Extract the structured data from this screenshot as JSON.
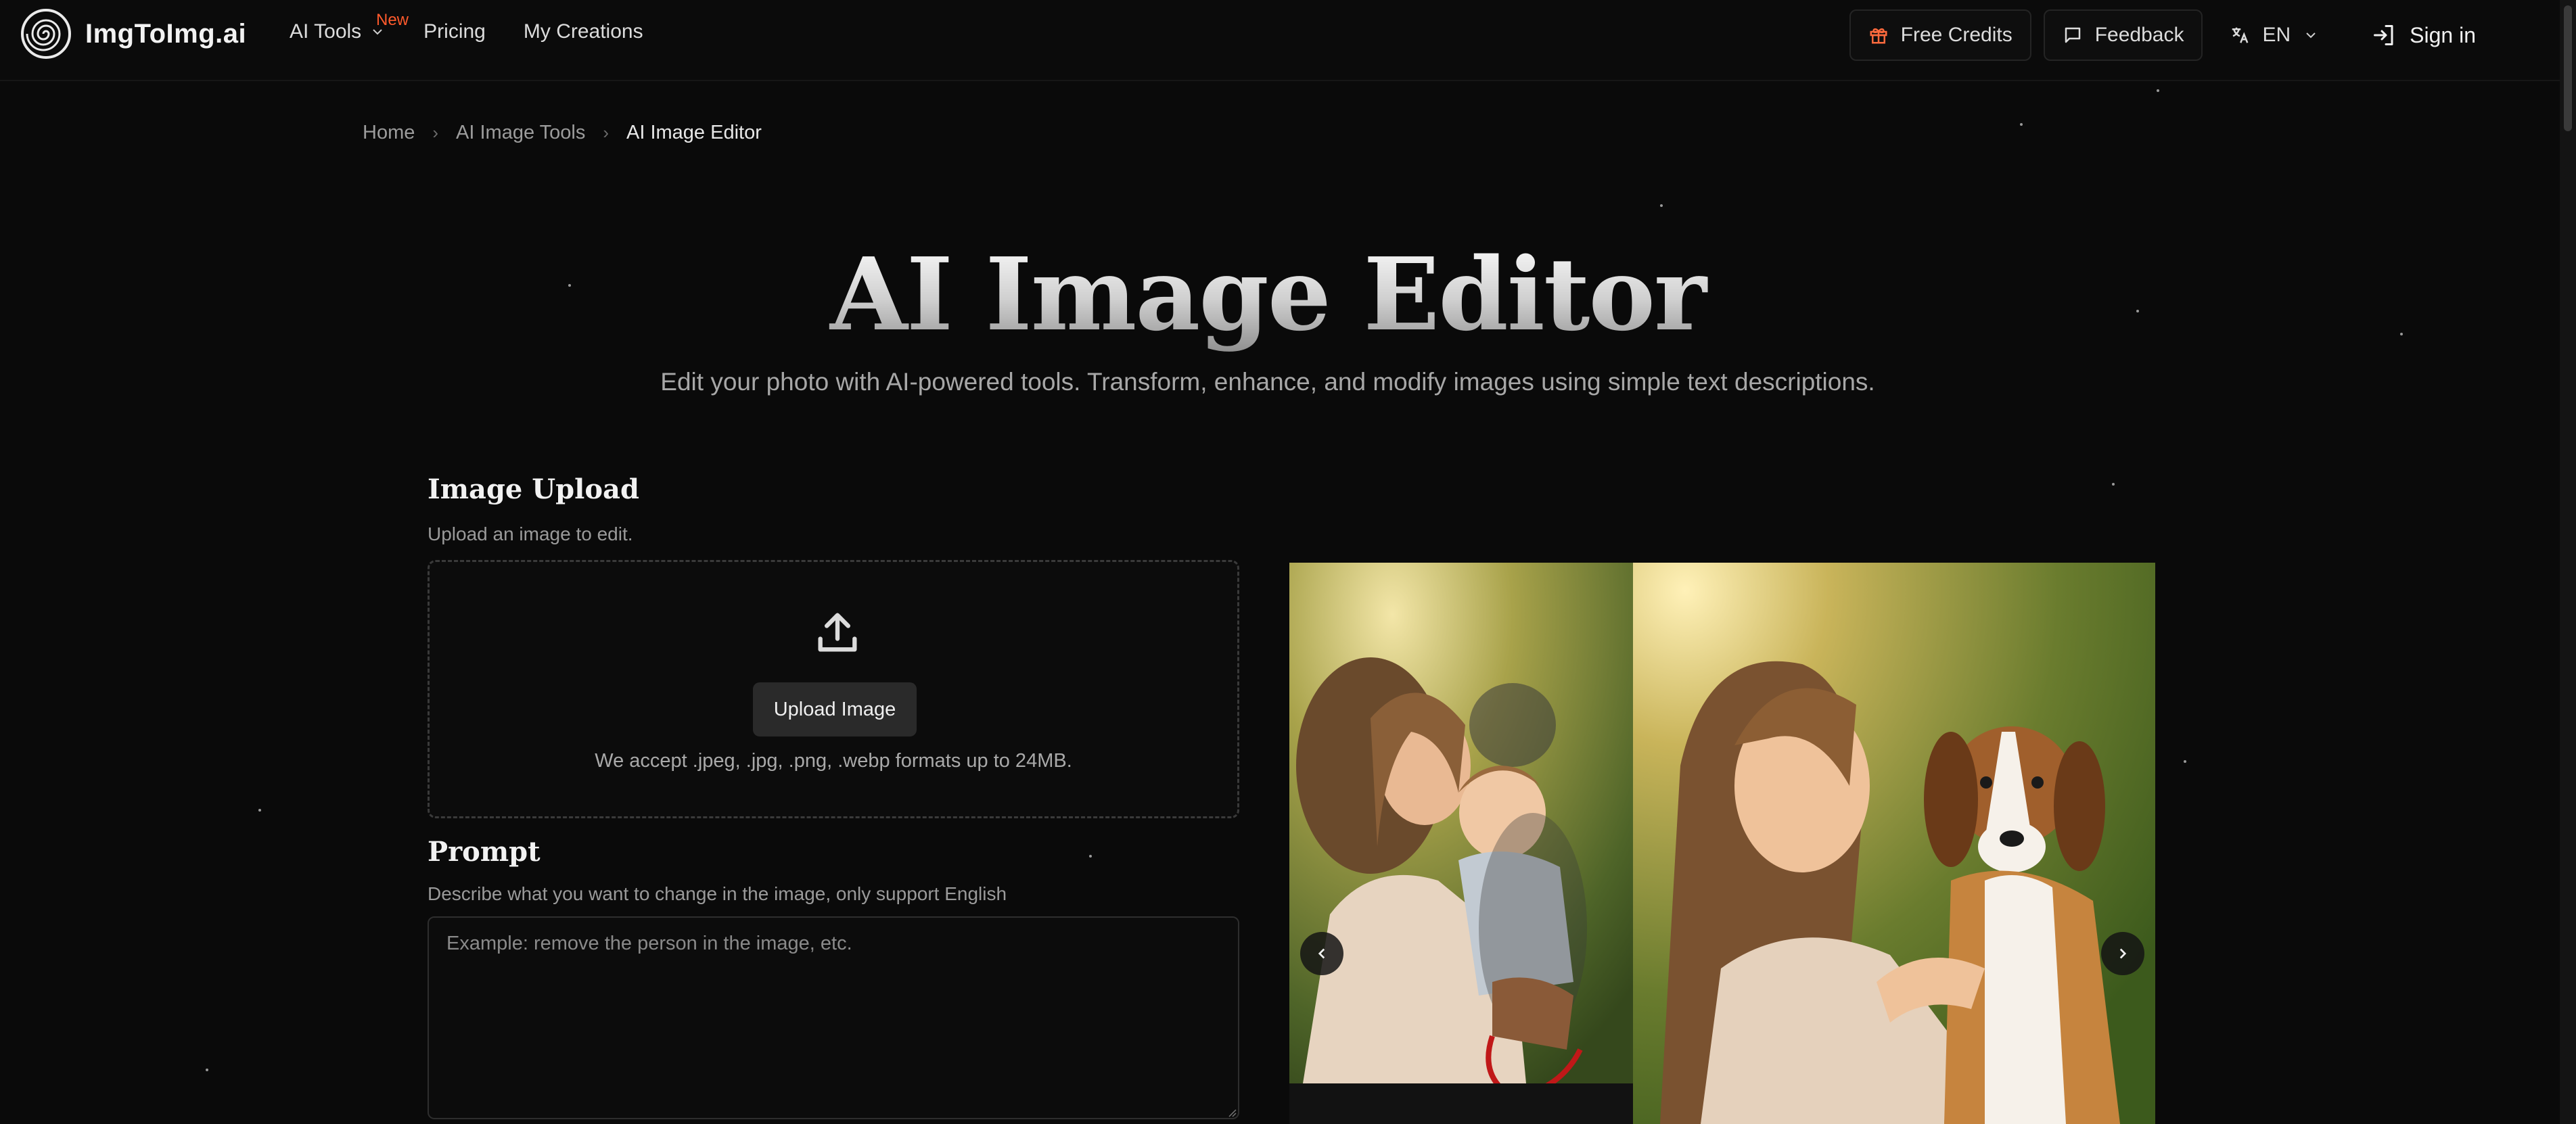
{
  "brand": {
    "name": "ImgToImg.ai"
  },
  "nav": {
    "ai_tools": "AI Tools",
    "new_badge": "New",
    "pricing": "Pricing",
    "my_creations": "My Creations",
    "free_credits": "Free Credits",
    "feedback": "Feedback",
    "language": "EN",
    "sign_in": "Sign in"
  },
  "breadcrumb": {
    "home": "Home",
    "tools": "AI Image Tools",
    "current": "AI Image Editor"
  },
  "hero": {
    "title": "AI Image Editor",
    "subtitle": "Edit your photo with AI-powered tools. Transform, enhance, and modify images using simple text descriptions."
  },
  "upload": {
    "title": "Image Upload",
    "description": "Upload an image to edit.",
    "button": "Upload Image",
    "note": "We accept .jpeg, .jpg, .png, .webp formats up to 24MB."
  },
  "prompt": {
    "title": "Prompt",
    "description": "Describe what you want to change in the image, only support English",
    "placeholder": "Example: remove the person in the image, etc."
  },
  "icons": {
    "logo": "spiral-logo-icon",
    "ai_tools": "chevron-down-icon",
    "free_credits": "gift-icon",
    "feedback": "message-icon",
    "language": "translate-icon",
    "sign_in": "sign-in-icon",
    "upload": "upload-icon",
    "prev": "chevron-left-icon",
    "next": "chevron-right-icon"
  },
  "colors": {
    "background": "#0a0a0a",
    "accent_new": "#ff5a2c",
    "gift_icon": "#ff6a3d"
  }
}
